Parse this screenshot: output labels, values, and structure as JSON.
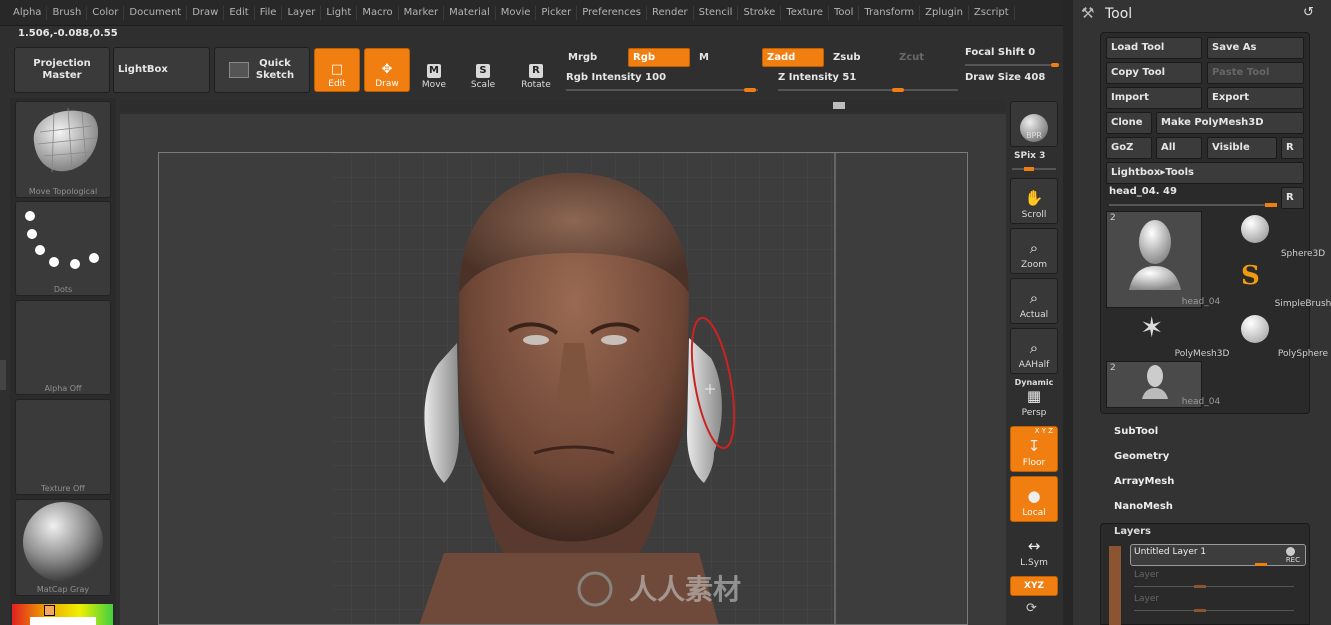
{
  "menu": [
    "Alpha",
    "Brush",
    "Color",
    "Document",
    "Draw",
    "Edit",
    "File",
    "Layer",
    "Light",
    "Macro",
    "Marker",
    "Material",
    "Movie",
    "Picker",
    "Preferences",
    "Render",
    "Stencil",
    "Stroke",
    "Texture",
    "Tool",
    "Transform",
    "Zplugin",
    "Zscript"
  ],
  "coords": "1.506,-0.088,0.55",
  "top": {
    "projection_master": "Projection Master",
    "lightbox": "LightBox",
    "quick_sketch": "Quick Sketch",
    "edit": "Edit",
    "draw": "Draw",
    "move": "Move",
    "scale": "Scale",
    "rotate": "Rotate",
    "mrgb": "Mrgb",
    "rgb": "Rgb",
    "m": "M",
    "zadd": "Zadd",
    "zsub": "Zsub",
    "zcut": "Zcut",
    "rgb_intensity": "Rgb Intensity 100",
    "z_intensity": "Z Intensity 51",
    "focal_shift": "Focal Shift 0",
    "draw_size": "Draw Size 408"
  },
  "left": {
    "brush_label": "Move Topological",
    "stroke_label": "Dots",
    "alpha_label": "Alpha Off",
    "texture_label": "Texture Off",
    "material_label": "MatCap Gray"
  },
  "rightbar": {
    "bpr": "BPR",
    "spix": "SPix 3",
    "scroll": "Scroll",
    "zoom": "Zoom",
    "actual": "Actual",
    "aahalf": "AAHalf",
    "dynamic": "Dynamic",
    "persp": "Persp",
    "floor": "Floor",
    "floor_axes": "X Y Z",
    "local": "Local",
    "lsym": "L.Sym",
    "xyz": "XYZ"
  },
  "toolpanel": {
    "title": "Tool",
    "load_tool": "Load Tool",
    "save_as": "Save As",
    "copy_tool": "Copy Tool",
    "paste_tool": "Paste Tool",
    "import": "Import",
    "export": "Export",
    "clone": "Clone",
    "make_polymesh": "Make PolyMesh3D",
    "goz": "GoZ",
    "all": "All",
    "visible": "Visible",
    "r": "R",
    "lightbox_tools": "Lightbox▸Tools",
    "current_tool": "head_04. 49",
    "tiles": [
      {
        "label": "head_04",
        "count": "2"
      },
      {
        "label": "Sphere3D"
      },
      {
        "label": "SimpleBrush"
      },
      {
        "label": "PolyMesh3D"
      },
      {
        "label": "PolySphere"
      },
      {
        "label": "head_04",
        "count": "2"
      }
    ],
    "subtool": "SubTool",
    "geometry": "Geometry",
    "arraymesh": "ArrayMesh",
    "nanomesh": "NanoMesh",
    "layers": "Layers",
    "layer_name": "Untitled Layer 1",
    "rec": "REC",
    "layer_placeholder": "Layer"
  },
  "watermark": "人人素材",
  "colors": {
    "accent": "#f07e10",
    "panel": "#333333",
    "canvas": "#3d3d3d"
  }
}
